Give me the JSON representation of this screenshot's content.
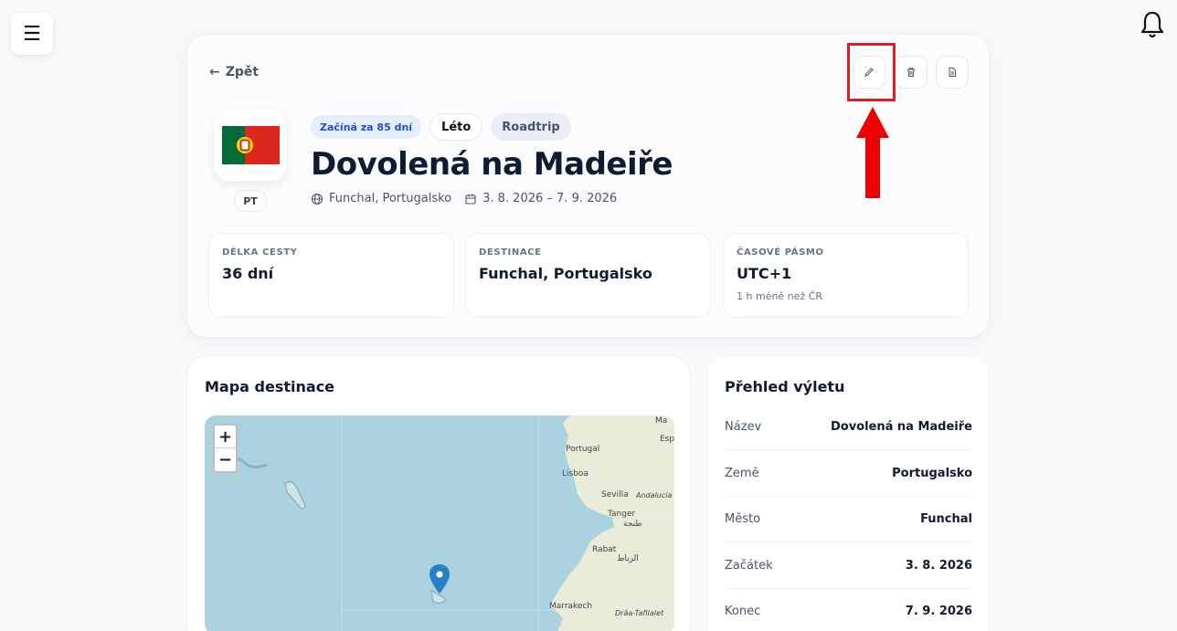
{
  "header": {
    "menu_icon": "hamburger-icon",
    "bell_icon": "bell-icon"
  },
  "trip": {
    "back_label": "Zpět",
    "country_code": "PT",
    "chips": [
      "Začíná za 85 dní",
      "Léto",
      "Roadtrip"
    ],
    "title": "Dovolená na Madeiře",
    "location": "Funchal, Portugalsko",
    "dates": "3. 8. 2026 – 7. 9. 2026",
    "actions": {
      "edit_icon": "pencil-icon",
      "delete_icon": "trash-icon",
      "export_icon": "document-icon"
    }
  },
  "stats": [
    {
      "label": "DÉLKA CESTY",
      "value": "36 dní",
      "sub": ""
    },
    {
      "label": "DESTINACE",
      "value": "Funchal, Portugalsko",
      "sub": ""
    },
    {
      "label": "ČASOVÉ PÁSMO",
      "value": "UTC+1",
      "sub": "1 h méně než ČR"
    }
  ],
  "map": {
    "title": "Mapa destinace",
    "zoom_in": "+",
    "zoom_out": "−",
    "labels": [
      "Ma",
      "Esp",
      "Portugal",
      "Lisboa",
      "Sevilla",
      "Andalucía",
      "Tanger",
      "طنجة",
      "Rabat",
      "الرباط",
      "Marrakech",
      "Drâa-Tafilalet"
    ]
  },
  "summary": {
    "title": "Přehled výletu",
    "rows": [
      {
        "key": "Název",
        "value": "Dovolená na Madeiře"
      },
      {
        "key": "Země",
        "value": "Portugalsko"
      },
      {
        "key": "Město",
        "value": "Funchal"
      },
      {
        "key": "Začátek",
        "value": "3. 8. 2026"
      },
      {
        "key": "Konec",
        "value": "7. 9. 2026"
      }
    ]
  },
  "colors": {
    "highlight": "#e11d1d",
    "accent": "#1d4ed8"
  }
}
